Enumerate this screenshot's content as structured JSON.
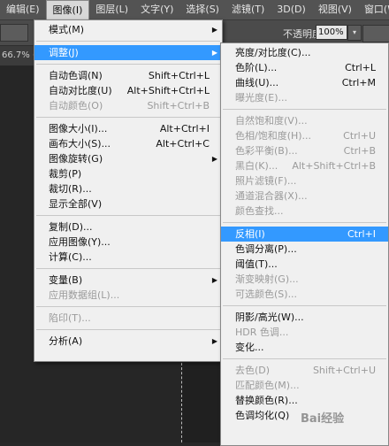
{
  "menubar": {
    "items": [
      "编辑(E)",
      "图像(I)",
      "图层(L)",
      "文字(Y)",
      "选择(S)",
      "滤镜(T)",
      "3D(D)",
      "视图(V)",
      "窗口(W"
    ],
    "active_index": 1
  },
  "options_bar": {
    "opacity_label": "不透明度:",
    "opacity_value": "100%"
  },
  "document": {
    "zoom_tab": "66.7% (图"
  },
  "image_menu": [
    {
      "label": "模式(M)",
      "shortcut": "",
      "submenu": true,
      "disabled": false
    },
    {
      "sep": true
    },
    {
      "label": "调整(J)",
      "shortcut": "",
      "submenu": true,
      "disabled": false,
      "highlighted": true
    },
    {
      "sep": true
    },
    {
      "label": "自动色调(N)",
      "shortcut": "Shift+Ctrl+L",
      "disabled": false
    },
    {
      "label": "自动对比度(U)",
      "shortcut": "Alt+Shift+Ctrl+L",
      "disabled": false
    },
    {
      "label": "自动颜色(O)",
      "shortcut": "Shift+Ctrl+B",
      "disabled": true
    },
    {
      "sep": true
    },
    {
      "label": "图像大小(I)...",
      "shortcut": "Alt+Ctrl+I",
      "disabled": false
    },
    {
      "label": "画布大小(S)...",
      "shortcut": "Alt+Ctrl+C",
      "disabled": false
    },
    {
      "label": "图像旋转(G)",
      "shortcut": "",
      "submenu": true,
      "disabled": false
    },
    {
      "label": "裁剪(P)",
      "shortcut": "",
      "disabled": false
    },
    {
      "label": "裁切(R)...",
      "shortcut": "",
      "disabled": false
    },
    {
      "label": "显示全部(V)",
      "shortcut": "",
      "disabled": false
    },
    {
      "sep": true
    },
    {
      "label": "复制(D)...",
      "shortcut": "",
      "disabled": false
    },
    {
      "label": "应用图像(Y)...",
      "shortcut": "",
      "disabled": false
    },
    {
      "label": "计算(C)...",
      "shortcut": "",
      "disabled": false
    },
    {
      "sep": true
    },
    {
      "label": "变量(B)",
      "shortcut": "",
      "submenu": true,
      "disabled": false
    },
    {
      "label": "应用数据组(L)...",
      "shortcut": "",
      "disabled": true
    },
    {
      "sep": true
    },
    {
      "label": "陷印(T)...",
      "shortcut": "",
      "disabled": true
    },
    {
      "sep": true
    },
    {
      "label": "分析(A)",
      "shortcut": "",
      "submenu": true,
      "disabled": false
    }
  ],
  "adjust_menu": [
    {
      "label": "亮度/对比度(C)...",
      "shortcut": "",
      "disabled": false
    },
    {
      "label": "色阶(L)...",
      "shortcut": "Ctrl+L",
      "disabled": false
    },
    {
      "label": "曲线(U)...",
      "shortcut": "Ctrl+M",
      "disabled": false
    },
    {
      "label": "曝光度(E)...",
      "shortcut": "",
      "disabled": true
    },
    {
      "sep": true
    },
    {
      "label": "自然饱和度(V)...",
      "shortcut": "",
      "disabled": true
    },
    {
      "label": "色相/饱和度(H)...",
      "shortcut": "Ctrl+U",
      "disabled": true
    },
    {
      "label": "色彩平衡(B)...",
      "shortcut": "Ctrl+B",
      "disabled": true
    },
    {
      "label": "黑白(K)...",
      "shortcut": "Alt+Shift+Ctrl+B",
      "disabled": true
    },
    {
      "label": "照片滤镜(F)...",
      "shortcut": "",
      "disabled": true
    },
    {
      "label": "通道混合器(X)...",
      "shortcut": "",
      "disabled": true
    },
    {
      "label": "颜色查找...",
      "shortcut": "",
      "disabled": true
    },
    {
      "sep": true
    },
    {
      "label": "反相(I)",
      "shortcut": "Ctrl+I",
      "disabled": false,
      "highlighted": true
    },
    {
      "label": "色调分离(P)...",
      "shortcut": "",
      "disabled": false
    },
    {
      "label": "阈值(T)...",
      "shortcut": "",
      "disabled": false
    },
    {
      "label": "渐变映射(G)...",
      "shortcut": "",
      "disabled": true
    },
    {
      "label": "可选颜色(S)...",
      "shortcut": "",
      "disabled": true
    },
    {
      "sep": true
    },
    {
      "label": "阴影/高光(W)...",
      "shortcut": "",
      "disabled": false
    },
    {
      "label": "HDR 色调...",
      "shortcut": "",
      "disabled": true
    },
    {
      "label": "变化...",
      "shortcut": "",
      "disabled": false
    },
    {
      "sep": true
    },
    {
      "label": "去色(D)",
      "shortcut": "Shift+Ctrl+U",
      "disabled": true
    },
    {
      "label": "匹配颜色(M)...",
      "shortcut": "",
      "disabled": true
    },
    {
      "label": "替换颜色(R)...",
      "shortcut": "",
      "disabled": false
    },
    {
      "label": "色调均化(Q)",
      "shortcut": "",
      "disabled": false
    }
  ],
  "watermark_text": "Bai经验"
}
